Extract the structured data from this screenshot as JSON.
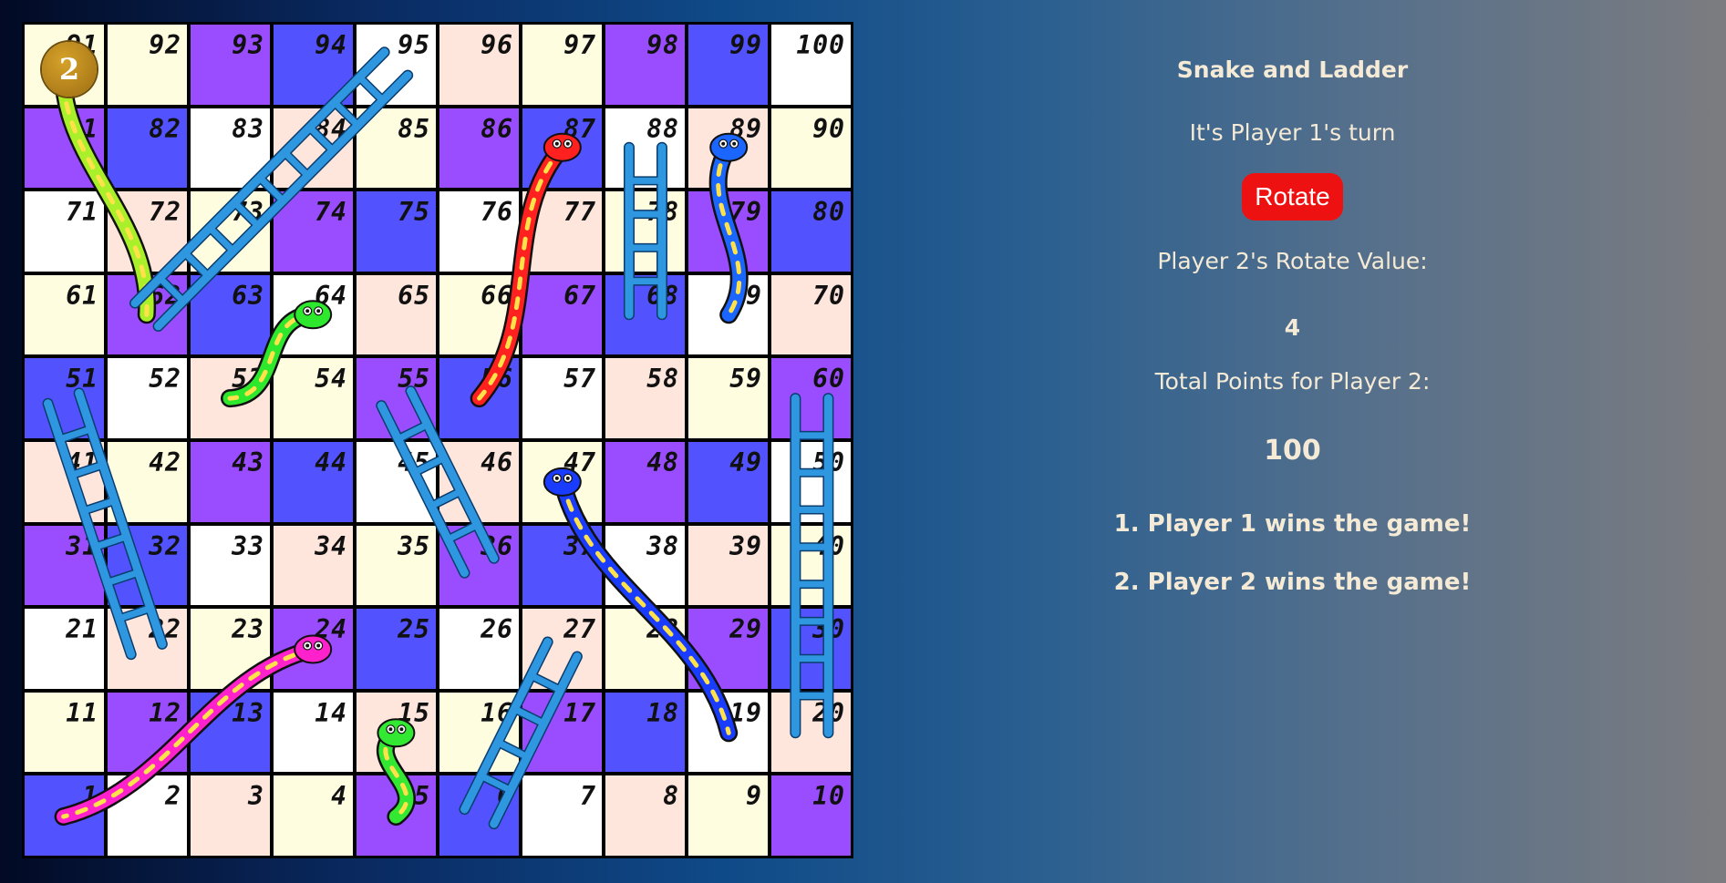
{
  "board": {
    "cells": [
      {
        "n": "91",
        "c": "#fffde0"
      },
      {
        "n": "92",
        "c": "#fffde0"
      },
      {
        "n": "93",
        "c": "#9a4dff"
      },
      {
        "n": "94",
        "c": "#5252ff"
      },
      {
        "n": "95",
        "c": "#ffffff"
      },
      {
        "n": "96",
        "c": "#ffe6dc"
      },
      {
        "n": "97",
        "c": "#fffde0"
      },
      {
        "n": "98",
        "c": "#9a4dff"
      },
      {
        "n": "99",
        "c": "#5252ff"
      },
      {
        "n": "100",
        "c": "#ffffff"
      },
      {
        "n": "81",
        "c": "#9a4dff"
      },
      {
        "n": "82",
        "c": "#5252ff"
      },
      {
        "n": "83",
        "c": "#ffffff"
      },
      {
        "n": "84",
        "c": "#ffe6dc"
      },
      {
        "n": "85",
        "c": "#fffde0"
      },
      {
        "n": "86",
        "c": "#9a4dff"
      },
      {
        "n": "87",
        "c": "#5252ff"
      },
      {
        "n": "88",
        "c": "#ffffff"
      },
      {
        "n": "89",
        "c": "#ffe6dc"
      },
      {
        "n": "90",
        "c": "#fffde0"
      },
      {
        "n": "71",
        "c": "#ffffff"
      },
      {
        "n": "72",
        "c": "#ffe6dc"
      },
      {
        "n": "73",
        "c": "#fffde0"
      },
      {
        "n": "74",
        "c": "#9a4dff"
      },
      {
        "n": "75",
        "c": "#5252ff"
      },
      {
        "n": "76",
        "c": "#ffffff"
      },
      {
        "n": "77",
        "c": "#ffe6dc"
      },
      {
        "n": "78",
        "c": "#fffde0"
      },
      {
        "n": "79",
        "c": "#9a4dff"
      },
      {
        "n": "80",
        "c": "#5252ff"
      },
      {
        "n": "61",
        "c": "#fffde0"
      },
      {
        "n": "62",
        "c": "#9a4dff"
      },
      {
        "n": "63",
        "c": "#5252ff"
      },
      {
        "n": "64",
        "c": "#ffffff"
      },
      {
        "n": "65",
        "c": "#ffe6dc"
      },
      {
        "n": "66",
        "c": "#fffde0"
      },
      {
        "n": "67",
        "c": "#9a4dff"
      },
      {
        "n": "68",
        "c": "#5252ff"
      },
      {
        "n": "69",
        "c": "#ffffff"
      },
      {
        "n": "70",
        "c": "#ffe6dc"
      },
      {
        "n": "51",
        "c": "#5252ff"
      },
      {
        "n": "52",
        "c": "#ffffff"
      },
      {
        "n": "53",
        "c": "#ffe6dc"
      },
      {
        "n": "54",
        "c": "#fffde0"
      },
      {
        "n": "55",
        "c": "#9a4dff"
      },
      {
        "n": "56",
        "c": "#5252ff"
      },
      {
        "n": "57",
        "c": "#ffffff"
      },
      {
        "n": "58",
        "c": "#ffe6dc"
      },
      {
        "n": "59",
        "c": "#fffde0"
      },
      {
        "n": "60",
        "c": "#9a4dff"
      },
      {
        "n": "41",
        "c": "#ffe6dc"
      },
      {
        "n": "42",
        "c": "#fffde0"
      },
      {
        "n": "43",
        "c": "#9a4dff"
      },
      {
        "n": "44",
        "c": "#5252ff"
      },
      {
        "n": "45",
        "c": "#ffffff"
      },
      {
        "n": "46",
        "c": "#ffe6dc"
      },
      {
        "n": "47",
        "c": "#fffde0"
      },
      {
        "n": "48",
        "c": "#9a4dff"
      },
      {
        "n": "49",
        "c": "#5252ff"
      },
      {
        "n": "50",
        "c": "#ffffff"
      },
      {
        "n": "31",
        "c": "#9a4dff"
      },
      {
        "n": "32",
        "c": "#5252ff"
      },
      {
        "n": "33",
        "c": "#ffffff"
      },
      {
        "n": "34",
        "c": "#ffe6dc"
      },
      {
        "n": "35",
        "c": "#fffde0"
      },
      {
        "n": "36",
        "c": "#9a4dff"
      },
      {
        "n": "37",
        "c": "#5252ff"
      },
      {
        "n": "38",
        "c": "#ffffff"
      },
      {
        "n": "39",
        "c": "#ffe6dc"
      },
      {
        "n": "40",
        "c": "#fffde0"
      },
      {
        "n": "21",
        "c": "#ffffff"
      },
      {
        "n": "22",
        "c": "#ffe6dc"
      },
      {
        "n": "23",
        "c": "#fffde0"
      },
      {
        "n": "24",
        "c": "#9a4dff"
      },
      {
        "n": "25",
        "c": "#5252ff"
      },
      {
        "n": "26",
        "c": "#ffffff"
      },
      {
        "n": "27",
        "c": "#ffe6dc"
      },
      {
        "n": "28",
        "c": "#fffde0"
      },
      {
        "n": "29",
        "c": "#9a4dff"
      },
      {
        "n": "30",
        "c": "#5252ff"
      },
      {
        "n": "11",
        "c": "#fffde0"
      },
      {
        "n": "12",
        "c": "#9a4dff"
      },
      {
        "n": "13",
        "c": "#5252ff"
      },
      {
        "n": "14",
        "c": "#ffffff"
      },
      {
        "n": "15",
        "c": "#ffe6dc"
      },
      {
        "n": "16",
        "c": "#fffde0"
      },
      {
        "n": "17",
        "c": "#9a4dff"
      },
      {
        "n": "18",
        "c": "#5252ff"
      },
      {
        "n": "19",
        "c": "#ffffff"
      },
      {
        "n": "20",
        "c": "#ffe6dc"
      },
      {
        "n": "1",
        "c": "#5252ff"
      },
      {
        "n": "2",
        "c": "#ffffff"
      },
      {
        "n": "3",
        "c": "#ffe6dc"
      },
      {
        "n": "4",
        "c": "#fffde0"
      },
      {
        "n": "5",
        "c": "#9a4dff"
      },
      {
        "n": "6",
        "c": "#5252ff"
      },
      {
        "n": "7",
        "c": "#ffffff"
      },
      {
        "n": "8",
        "c": "#ffe6dc"
      },
      {
        "n": "9",
        "c": "#fffde0"
      },
      {
        "n": "10",
        "c": "#9a4dff"
      }
    ],
    "token": {
      "label": "2",
      "square": 91
    },
    "ladders": [
      {
        "from": 62,
        "to": 95,
        "color": "#2e97e0"
      },
      {
        "from": 68,
        "to": 88,
        "color": "#2e97e0"
      },
      {
        "from": 22,
        "to": 51,
        "color": "#2e97e0"
      },
      {
        "from": 36,
        "to": 55,
        "color": "#2e97e0"
      },
      {
        "from": 6,
        "to": 27,
        "color": "#2e97e0"
      },
      {
        "from": 20,
        "to": 60,
        "color": "#2e97e0"
      }
    ],
    "snakes": [
      {
        "head": 91,
        "tail": 62,
        "color": "#aaf02a",
        "name": "yellow-green"
      },
      {
        "head": 89,
        "tail": 69,
        "color": "#1a66ff",
        "name": "teal-blue"
      },
      {
        "head": 87,
        "tail": 56,
        "color": "#ff2020",
        "name": "red"
      },
      {
        "head": 64,
        "tail": 53,
        "color": "#2ee82e",
        "name": "light-green"
      },
      {
        "head": 47,
        "tail": 19,
        "color": "#1a3cff",
        "name": "blue"
      },
      {
        "head": 24,
        "tail": 1,
        "color": "#ff22cc",
        "name": "magenta"
      },
      {
        "head": 15,
        "tail": 5,
        "color": "#33e833",
        "name": "green"
      }
    ]
  },
  "panel": {
    "title": "Snake and Ladder",
    "turn_text": "It's Player 1's turn",
    "rotate_label": "Rotate",
    "rotate_value_label": "Player 2's Rotate Value:",
    "rotate_value": "4",
    "points_label": "Total Points for Player 2:",
    "points_value": "100",
    "results": [
      "1. Player 1 wins the game!",
      "2. Player 2 wins the game!"
    ]
  }
}
